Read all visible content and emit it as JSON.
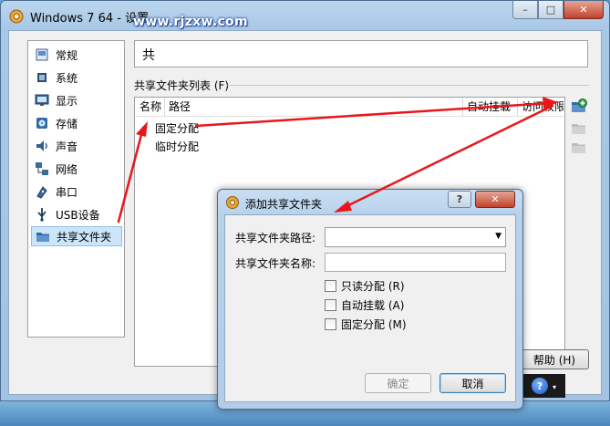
{
  "window": {
    "title": "Windows 7 64 - 设置",
    "minimize_glyph": "–",
    "maximize_glyph": "□",
    "close_glyph": "✕"
  },
  "sidebar": {
    "items": [
      {
        "label": "常规",
        "icon": "general-icon"
      },
      {
        "label": "系统",
        "icon": "system-chip-icon"
      },
      {
        "label": "显示",
        "icon": "display-monitor-icon"
      },
      {
        "label": "存储",
        "icon": "storage-disk-icon"
      },
      {
        "label": "声音",
        "icon": "speaker-icon"
      },
      {
        "label": "网络",
        "icon": "network-icon"
      },
      {
        "label": "串口",
        "icon": "serial-port-icon"
      },
      {
        "label": "USB设备",
        "icon": "usb-icon"
      },
      {
        "label": "共享文件夹",
        "icon": "shared-folder-icon",
        "selected": true
      }
    ]
  },
  "page": {
    "name_title": "共",
    "section_label": "共享文件夹列表 (F)",
    "columns": [
      "名称",
      "路径",
      "自动挂载",
      "访问权限"
    ],
    "rows": [
      "固定分配",
      "临时分配"
    ],
    "help_button": "帮助 (H)"
  },
  "watermark": "www.rjzxw.com",
  "tray": {
    "help_glyph": "?",
    "arrow_glyph": "▾"
  },
  "dialog": {
    "title": "添加共享文件夹",
    "help_glyph": "?",
    "close_glyph": "✕",
    "path_label": "共享文件夹路径:",
    "path_value": "",
    "name_label": "共享文件夹名称:",
    "name_value": "",
    "checkboxes": [
      {
        "label": "只读分配 (R)",
        "checked": false
      },
      {
        "label": "自动挂载 (A)",
        "checked": false
      },
      {
        "label": "固定分配 (M)",
        "checked": false
      }
    ],
    "ok_button": "确定",
    "cancel_button": "取消"
  },
  "colors": {
    "annotation_arrow": "#e8171b",
    "selection": "#cde5f8",
    "title_bar": "#b7d1eb"
  }
}
